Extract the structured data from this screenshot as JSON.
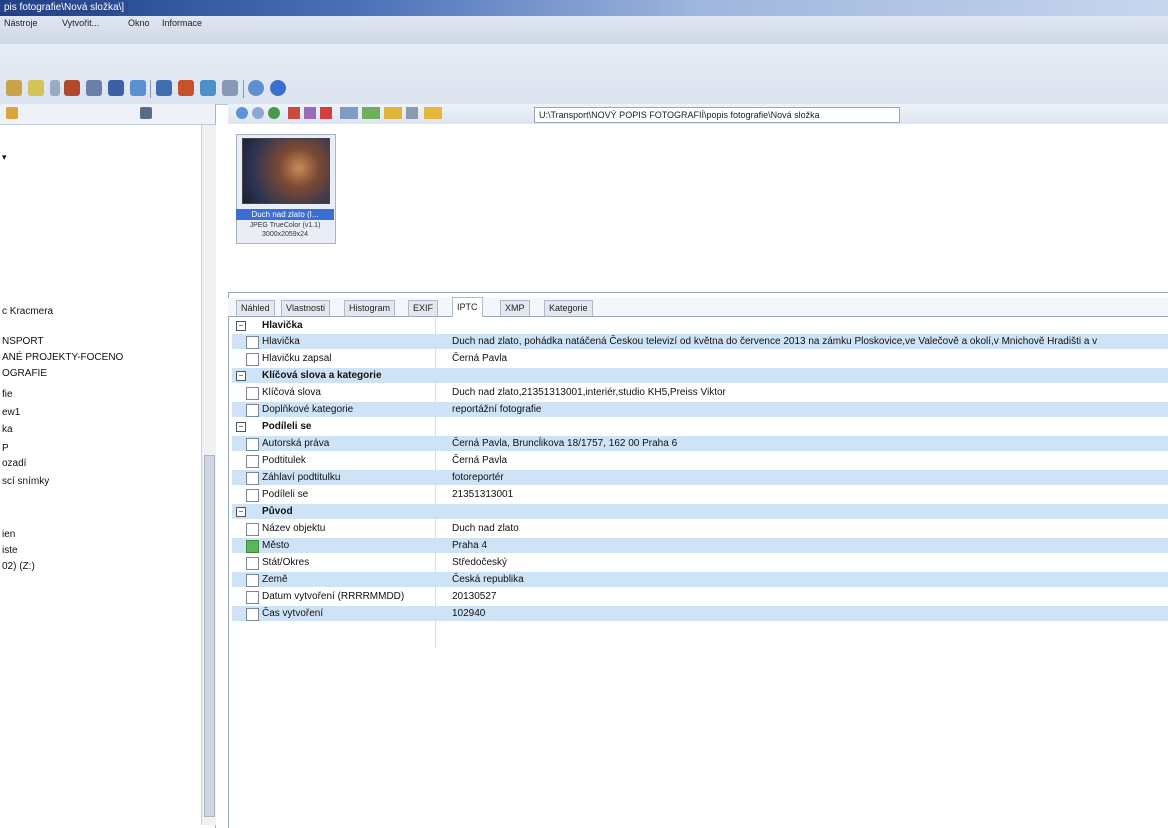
{
  "window": {
    "title": "pis fotografie\\Nová složka\\]"
  },
  "menu": {
    "items": [
      "Nástroje",
      "Vytvořit...",
      "Okno",
      "Informace"
    ]
  },
  "address": {
    "path": "U:\\Transport\\NOVÝ POPIS FOTOGRAFIÍ\\popis fotografie\\Nová složka"
  },
  "left_pane": {
    "items": [
      "c Kracmera",
      "NSPORT",
      "ANÉ PROJEKTY-FOCENO",
      "OGRAFIE",
      "fie",
      "ew1",
      "ka",
      "P",
      "ozadí",
      "scí snímky",
      "ien",
      "iste",
      "02) (Z:)"
    ]
  },
  "thumbnail": {
    "caption": "Duch nad zlato (I...",
    "format": "JPEG TrueColor (v1.1)",
    "dimensions": "3000x2059x24"
  },
  "tabs": [
    "Náhled",
    "Vlastnosti",
    "Histogram",
    "EXIF",
    "IPTC",
    "XMP",
    "Kategorie"
  ],
  "active_tab": "IPTC",
  "iptc": {
    "groups": [
      {
        "title": "Hlavička",
        "fields": [
          {
            "name": "Hlavička",
            "value": "Duch nad zlato, pohádka natáčená Českou televizí od května do července 2013 na zámku Ploskovice,ve Valečově a okolí,v Mnichově Hradišti a v"
          },
          {
            "name": "Hlavičku zapsal",
            "value": "Černá Pavla"
          }
        ]
      },
      {
        "title": "Klíčová slova a kategorie",
        "fields": [
          {
            "name": "Klíčová slova",
            "value": "Duch nad zlato,21351313001,interiér,studio KH5,Preiss Viktor"
          },
          {
            "name": "Doplňkové kategorie",
            "value": "reportážní fotografie"
          }
        ]
      },
      {
        "title": "Podíleli se",
        "fields": [
          {
            "name": "Autorská práva",
            "value": "Černá Pavla, Bruncĺikova 18/1757, 162 00 Praha 6"
          },
          {
            "name": "Podtitulek",
            "value": "Černá Pavla"
          },
          {
            "name": "Záhlaví podtitulku",
            "value": "fotoreportér"
          },
          {
            "name": "Podíleli se",
            "value": "21351313001"
          }
        ]
      },
      {
        "title": "Původ",
        "fields": [
          {
            "name": "Název objektu",
            "value": "Duch nad zlato"
          },
          {
            "name": "Město",
            "value": "Praha 4"
          },
          {
            "name": "Stát/Okres",
            "value": "Středočeský"
          },
          {
            "name": "Země",
            "value": "Česká republika"
          },
          {
            "name": "Datum vytvoření (RRRRMMDD)",
            "value": "20130527"
          },
          {
            "name": "Čas vytvoření",
            "value": "102940"
          }
        ]
      }
    ]
  }
}
